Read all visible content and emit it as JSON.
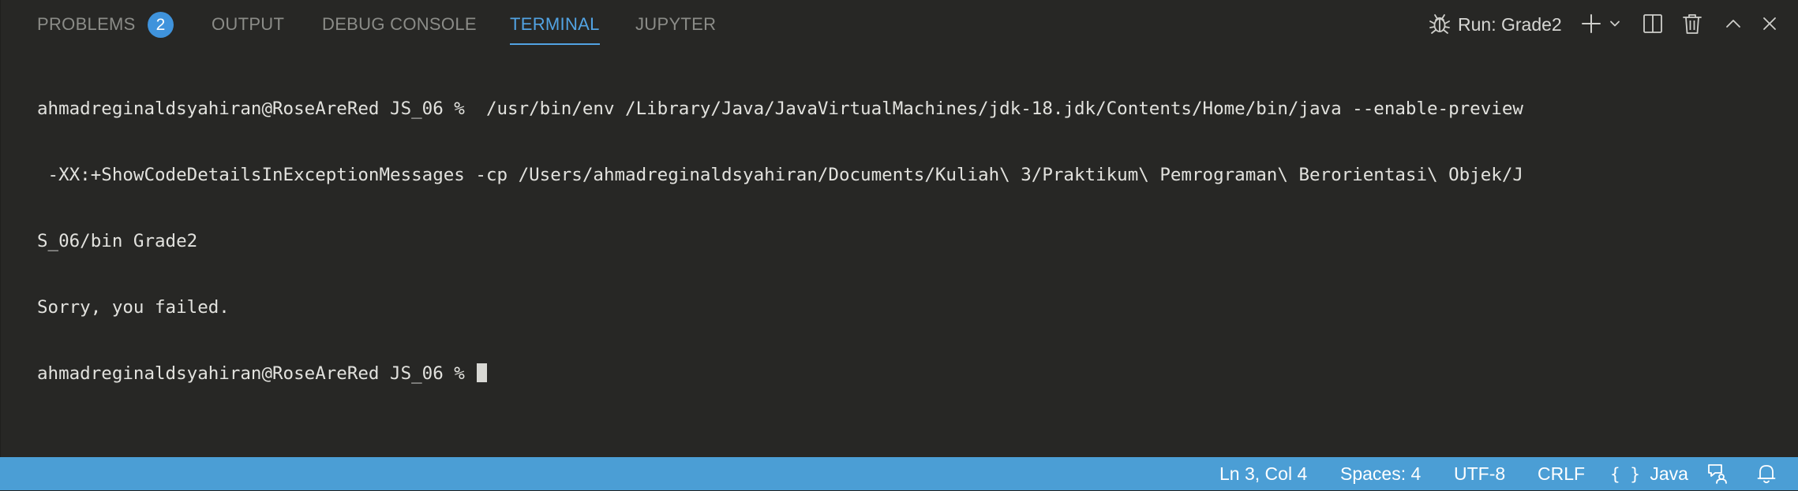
{
  "tabs": [
    {
      "label": "PROBLEMS",
      "active": false
    },
    {
      "label": "OUTPUT",
      "active": false
    },
    {
      "label": "DEBUG CONSOLE",
      "active": false
    },
    {
      "label": "TERMINAL",
      "active": true
    },
    {
      "label": "JUPYTER",
      "active": false
    }
  ],
  "problems_count": "2",
  "toolbar": {
    "run_label": "Run: Grade2",
    "icons": [
      "debug-icon",
      "plus-icon",
      "chevron-down-icon",
      "split-icon",
      "trash-icon",
      "chevron-up-icon",
      "close-icon"
    ]
  },
  "terminal": {
    "lines": [
      "ahmadreginaldsyahiran@RoseAreRed JS_06 %  /usr/bin/env /Library/Java/JavaVirtualMachines/jdk-18.jdk/Contents/Home/bin/java --enable-preview",
      " -XX:+ShowCodeDetailsInExceptionMessages -cp /Users/ahmadreginaldsyahiran/Documents/Kuliah\\ 3/Praktikum\\ Pemrograman\\ Berorientasi\\ Objek/J",
      "S_06/bin Grade2",
      "Sorry, you failed.",
      "ahmadreginaldsyahiran@RoseAreRed JS_06 % "
    ]
  },
  "statusbar": {
    "position": "Ln 3, Col 4",
    "spaces": "Spaces: 4",
    "encoding": "UTF-8",
    "eol": "CRLF",
    "language_brace": "{ }",
    "language": "Java"
  },
  "colors": {
    "accent": "#52a3e3",
    "statusbar": "#4b9ed5",
    "background": "#272725"
  }
}
